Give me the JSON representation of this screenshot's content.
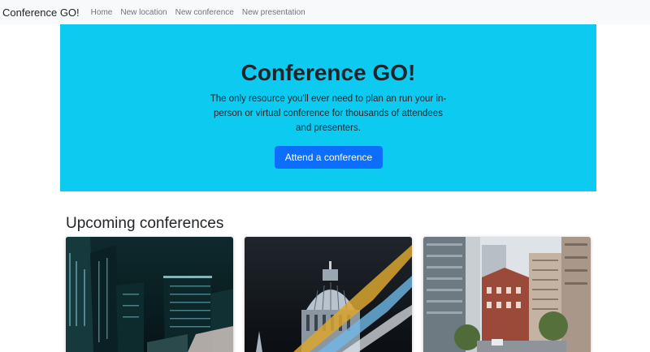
{
  "navbar": {
    "brand": "Conference GO!",
    "links": [
      "Home",
      "New location",
      "New conference",
      "New presentation"
    ]
  },
  "hero": {
    "title": "Conference GO!",
    "lead": "The only resource you'll ever need to plan an run your in-person or virtual conference for thousands of attendees and presenters.",
    "button": "Attend a conference"
  },
  "upcoming": {
    "title": "Upcoming conferences"
  },
  "colors": {
    "hero_bg": "#0dcaf0",
    "primary": "#0d6efd",
    "navbar_bg": "#f8f9fa"
  }
}
